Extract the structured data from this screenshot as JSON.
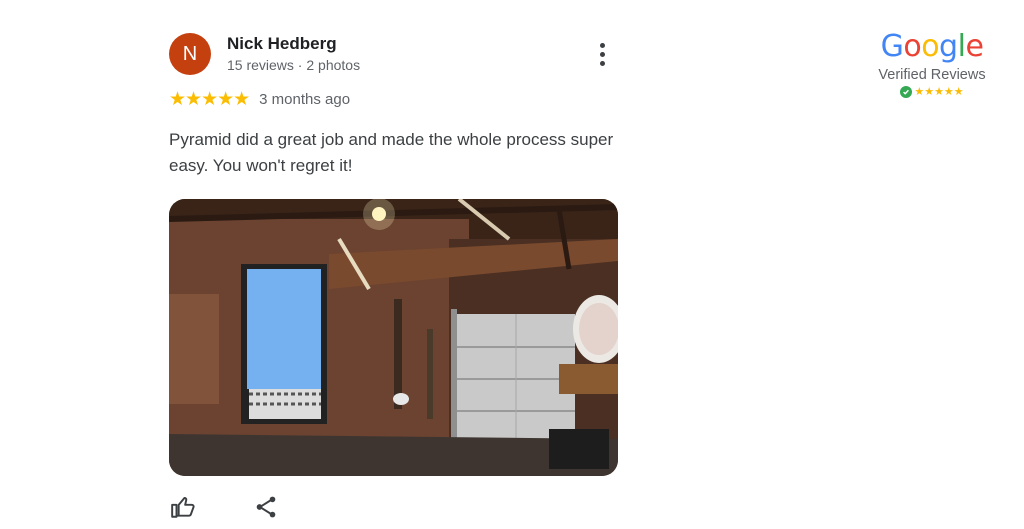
{
  "reviewer": {
    "initial": "N",
    "name": "Nick Hedberg",
    "meta": "15 reviews · 2 photos",
    "avatar_color": "#c4400f"
  },
  "review": {
    "stars": "★★★★★",
    "rating": 5,
    "date": "3 months ago",
    "text": "Pyramid did a great job and made the whole process super easy. You won't regret it!"
  },
  "photo": {
    "subject": "garage interior photo"
  },
  "actions": {
    "like_icon": "thumbs-up-icon",
    "share_icon": "share-icon",
    "more_icon": "more-vert-icon"
  },
  "badge": {
    "logo_letters": [
      "G",
      "o",
      "o",
      "g",
      "l",
      "e"
    ],
    "logo_colors": [
      "#4285f4",
      "#ea4335",
      "#fbbc05",
      "#4285f4",
      "#34a853",
      "#ea4335"
    ],
    "verified_label": "Verified Reviews",
    "stars": "★★★★★",
    "check_icon": "check-circle-icon"
  },
  "colors": {
    "star": "#fbbc04",
    "text_primary": "#202124",
    "text_secondary": "#5f6368"
  }
}
